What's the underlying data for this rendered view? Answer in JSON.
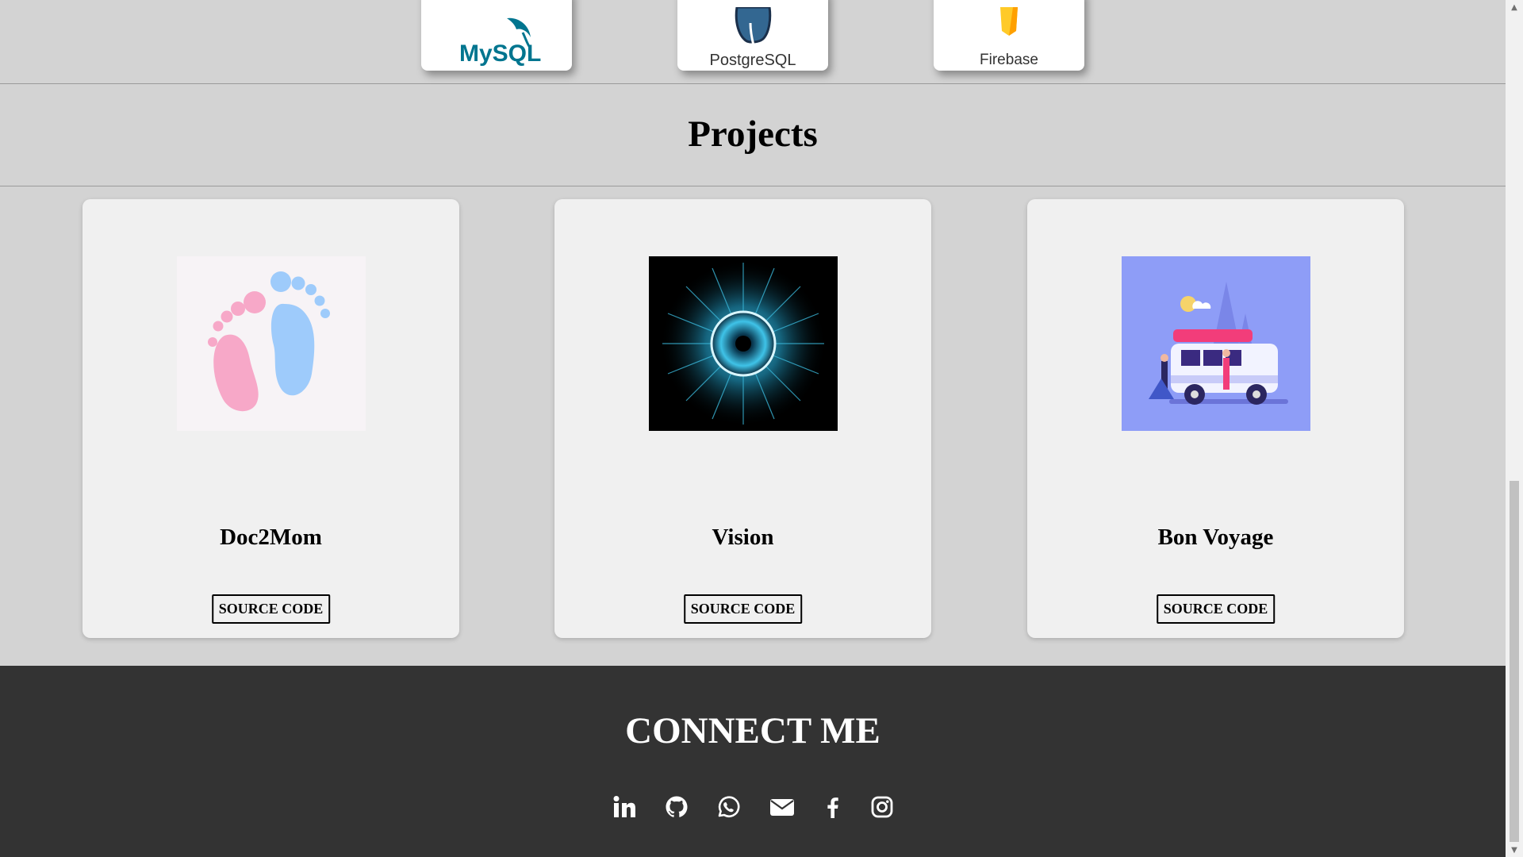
{
  "skills": [
    {
      "name": "MySQL",
      "icon": "mysql-logo-icon"
    },
    {
      "name": "PostgreSQL",
      "icon": "postgresql-logo-icon"
    },
    {
      "name": "Firebase",
      "icon": "firebase-logo-icon"
    }
  ],
  "projects_section": {
    "heading": "Projects"
  },
  "projects": [
    {
      "title": "Doc2Mom",
      "button": "SOURCE CODE",
      "image": "baby-footprints-image"
    },
    {
      "title": "Vision",
      "button": "SOURCE CODE",
      "image": "digital-eye-image"
    },
    {
      "title": "Bon Voyage",
      "button": "SOURCE CODE",
      "image": "road-trip-van-image"
    }
  ],
  "footer": {
    "heading": "CONNECT ME",
    "social": [
      "linkedin-icon",
      "github-icon",
      "whatsapp-icon",
      "email-icon",
      "facebook-icon",
      "instagram-icon"
    ]
  },
  "colors": {
    "page_bg": "#d3d3d3",
    "card_bg": "#f0f0f0",
    "footer_bg": "#333333",
    "mysql_blue": "#00758f",
    "mysql_orange": "#f29111",
    "firebase_yellow": "#ffca28",
    "postgres_blue": "#336791"
  }
}
